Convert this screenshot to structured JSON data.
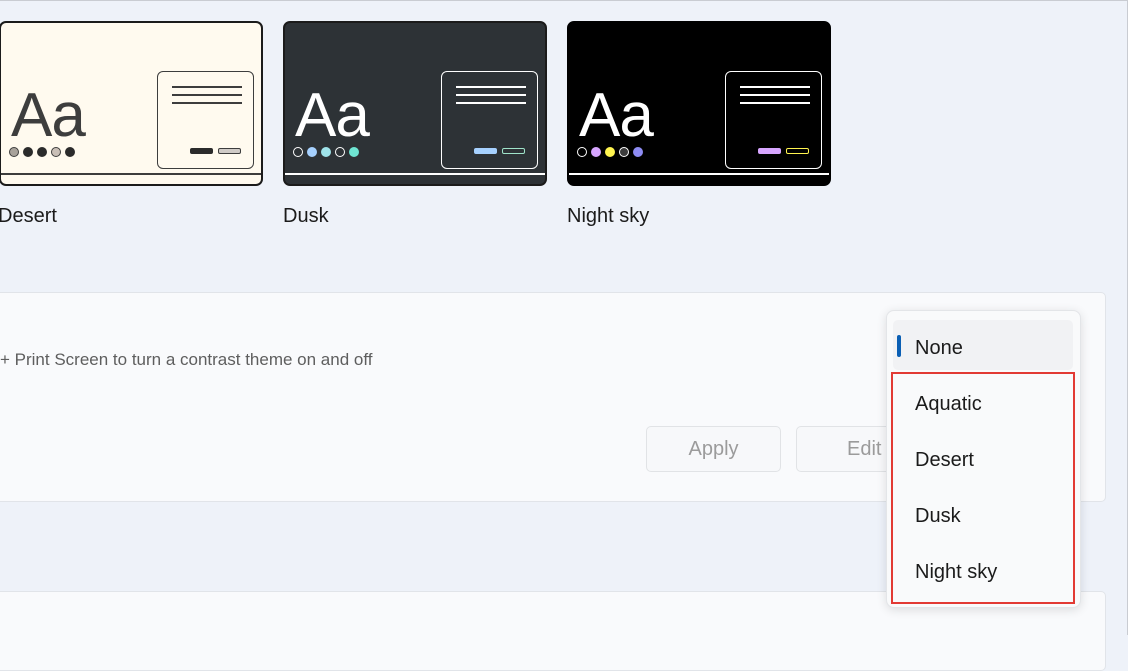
{
  "themes": [
    {
      "name": "Desert",
      "bg": "#fffaef",
      "border": "#1b1b1b",
      "text_color": "#3d3d3d",
      "window_border": "#3d3d3d",
      "line_color": "#3d3d3d",
      "bar_color": "#3d3d3d",
      "dots": [
        {
          "fill": "#a8a29b",
          "stroke": "#3d3d3d"
        },
        {
          "fill": "#2b2b2b",
          "stroke": "#2b2b2b"
        },
        {
          "fill": "#2b2b2b",
          "stroke": "#2b2b2b"
        },
        {
          "fill": "#c9bfb7",
          "stroke": "#3d3d3d"
        },
        {
          "fill": "#2b2b2b",
          "stroke": "#2b2b2b"
        }
      ],
      "swatch1": {
        "fill": "#2b2b2b",
        "stroke": "#2b2b2b"
      },
      "swatch2": {
        "fill": "#d0cbc7",
        "stroke": "#3d3d3d"
      }
    },
    {
      "name": "Dusk",
      "bg": "#2d3236",
      "border": "#1b1b1b",
      "text_color": "#ffffff",
      "window_border": "#ffffff",
      "line_color": "#ffffff",
      "bar_color": "#ffffff",
      "dots": [
        {
          "fill": "#2d3236",
          "stroke": "#ffffff"
        },
        {
          "fill": "#a6d1ff",
          "stroke": "#a6d1ff"
        },
        {
          "fill": "#9fe3ea",
          "stroke": "#9fe3ea"
        },
        {
          "fill": "#2d3236",
          "stroke": "#ffffff"
        },
        {
          "fill": "#6fe5d3",
          "stroke": "#6fe5d3"
        }
      ],
      "swatch1": {
        "fill": "#a6d1ff",
        "stroke": "#a6d1ff"
      },
      "swatch2": {
        "fill": "#2d3236",
        "stroke": "#9fe3c9"
      }
    },
    {
      "name": "Night sky",
      "bg": "#000000",
      "border": "#000000",
      "text_color": "#ffffff",
      "window_border": "#ffffff",
      "line_color": "#ffffff",
      "bar_color": "#ffffff",
      "dots": [
        {
          "fill": "#000000",
          "stroke": "#ffffff"
        },
        {
          "fill": "#d7a6ff",
          "stroke": "#d7a6ff"
        },
        {
          "fill": "#fff44f",
          "stroke": "#fff44f"
        },
        {
          "fill": "#3b3b3b",
          "stroke": "#ffffff"
        },
        {
          "fill": "#8e8cf3",
          "stroke": "#8e8cf3"
        }
      ],
      "swatch1": {
        "fill": "#d7a6ff",
        "stroke": "#d7a6ff"
      },
      "swatch2": {
        "fill": "#000000",
        "stroke": "#fff44f"
      }
    }
  ],
  "sample_text": "Aa",
  "shortcut_hint": "+ Print Screen to turn a contrast theme on and off",
  "buttons": {
    "apply": "Apply",
    "edit": "Edit"
  },
  "dropdown": {
    "selected": "None",
    "options": [
      "Aquatic",
      "Desert",
      "Dusk",
      "Night sky"
    ],
    "accent_color": "#0a5fb4",
    "highlight_color": "#e23a34"
  }
}
